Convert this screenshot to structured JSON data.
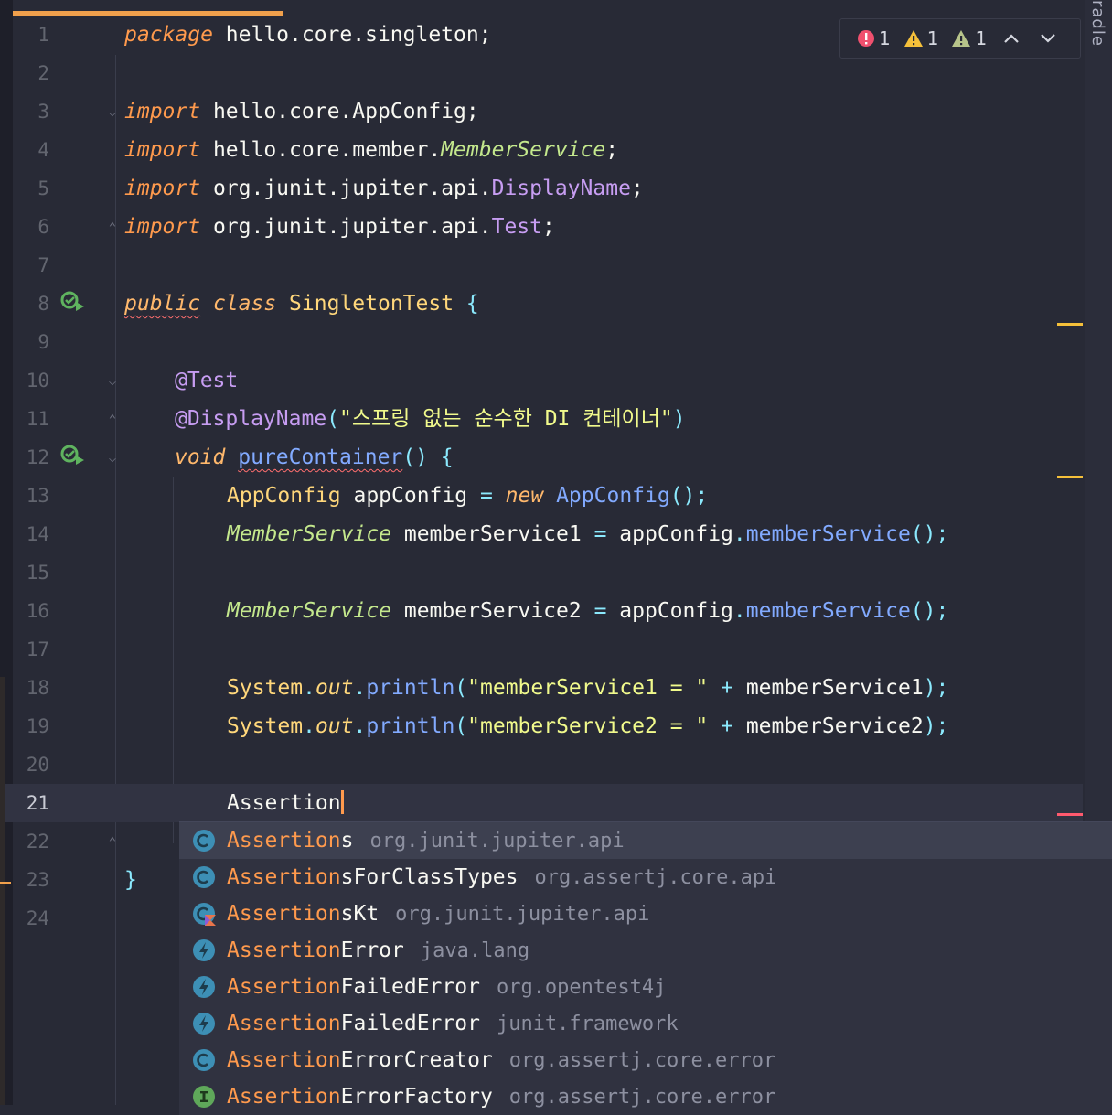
{
  "inspections": {
    "errors": "1",
    "warnings": "1",
    "weak_warnings": "1"
  },
  "side_panel": {
    "label": "radle"
  },
  "lines": [
    {
      "n": "1"
    },
    {
      "n": "2"
    },
    {
      "n": "3"
    },
    {
      "n": "4"
    },
    {
      "n": "5"
    },
    {
      "n": "6"
    },
    {
      "n": "7"
    },
    {
      "n": "8"
    },
    {
      "n": "9"
    },
    {
      "n": "10"
    },
    {
      "n": "11"
    },
    {
      "n": "12"
    },
    {
      "n": "13"
    },
    {
      "n": "14"
    },
    {
      "n": "15"
    },
    {
      "n": "16"
    },
    {
      "n": "17"
    },
    {
      "n": "18"
    },
    {
      "n": "19"
    },
    {
      "n": "20"
    },
    {
      "n": "21"
    },
    {
      "n": "22"
    },
    {
      "n": "23"
    },
    {
      "n": "24"
    }
  ],
  "code": {
    "l1_kw": "package",
    "l1_rest": " hello.core.singleton;",
    "l3_kw": "import",
    "l3_rest": " hello.core.AppConfig;",
    "l4_kw": "import",
    "l4_pkg": " hello.core.member.",
    "l4_cls": "MemberService",
    "l4_end": ";",
    "l5_kw": "import",
    "l5_pkg": " org.junit.jupiter.api.",
    "l5_cls": "DisplayName",
    "l5_end": ";",
    "l6_kw": "import",
    "l6_pkg": " org.junit.jupiter.api.",
    "l6_cls": "Test",
    "l6_end": ";",
    "l8_kw1": "public",
    "l8_kw2": "class",
    "l8_name": " SingletonTest ",
    "l8_brace": "{",
    "l10_ann": "@Test",
    "l11_ann": "@DisplayName",
    "l11_open": "(",
    "l11_str": "\"스프링 없는 순수한 DI 컨테이너\"",
    "l11_close": ")",
    "l12_kw": "void",
    "l12_fn": "pureContainer",
    "l12_rest": "() {",
    "l13_type": "AppConfig",
    "l13_var": " appConfig ",
    "l13_eq": "=",
    "l13_new": "new",
    "l13_cls": "AppConfig",
    "l13_end": "();",
    "l14_type": "MemberService",
    "l14_var": " memberService1 ",
    "l14_eq": "=",
    "l14_obj": " appConfig",
    "l14_dot": ".",
    "l14_fn": "memberService",
    "l14_end": "();",
    "l16_type": "MemberService",
    "l16_var": " memberService2 ",
    "l16_eq": "=",
    "l16_obj": " appConfig",
    "l16_dot": ".",
    "l16_fn": "memberService",
    "l16_end": "();",
    "l18_sys": "System",
    "l18_dot": ".",
    "l18_out": "out",
    "l18_dot2": ".",
    "l18_fn": "println",
    "l18_open": "(",
    "l18_str": "\"memberService1 = \"",
    "l18_plus": " + ",
    "l18_var": "memberService1",
    "l18_end": ");",
    "l19_sys": "System",
    "l19_dot": ".",
    "l19_out": "out",
    "l19_dot2": ".",
    "l19_fn": "println",
    "l19_open": "(",
    "l19_str": "\"memberService2 = \"",
    "l19_plus": " + ",
    "l19_var": "memberService2",
    "l19_end": ");",
    "l21_typed": "Assertion",
    "l23_brace": "}"
  },
  "completion": {
    "items": [
      {
        "match": "Assertion",
        "rest": "s",
        "pkg": "org.junit.jupiter.api",
        "icon": "class-icon"
      },
      {
        "match": "Assertion",
        "rest": "sForClassTypes",
        "pkg": "org.assertj.core.api",
        "icon": "class-icon"
      },
      {
        "match": "Assertion",
        "rest": "sKt",
        "pkg": "org.junit.jupiter.api",
        "icon": "kotlin-class-icon"
      },
      {
        "match": "Assertion",
        "rest": "Error",
        "pkg": "java.lang",
        "icon": "exception-icon"
      },
      {
        "match": "Assertion",
        "rest": "FailedError",
        "pkg": "org.opentest4j",
        "icon": "exception-icon"
      },
      {
        "match": "Assertion",
        "rest": "FailedError",
        "pkg": "junit.framework",
        "icon": "exception-icon"
      },
      {
        "match": "Assertion",
        "rest": "ErrorCreator",
        "pkg": "org.assertj.core.error",
        "icon": "class-icon"
      },
      {
        "match": "Assertion",
        "rest": "ErrorFactory",
        "pkg": "org.assertj.core.error",
        "icon": "interface-icon"
      }
    ]
  },
  "colors": {
    "background": "#282a36",
    "keyword": "#ff9a4d",
    "annotation": "#c79df2",
    "string": "#f1fa8c",
    "method": "#82aaff",
    "error": "#ff5a6e",
    "warning": "#f5c03a"
  }
}
